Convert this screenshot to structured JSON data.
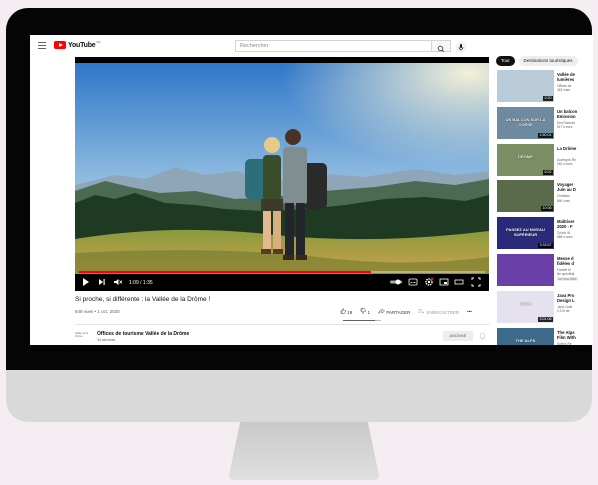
{
  "youtube": {
    "logo_text": "YouTube",
    "logo_region": "FR",
    "search_placeholder": "Rechercher",
    "chips": [
      "Tout",
      "Destinations touristiques"
    ],
    "player": {
      "time": "1:09 / 1:35",
      "progress_fraction": 0.72
    },
    "video": {
      "title": "Si proche, si différente : la Vallée de la Drôme !",
      "meta": "848 vues • 1 oct. 2020",
      "likes": "19",
      "dislikes": "1",
      "share_label": "PARTAGER",
      "save_label": "ENREGISTRER",
      "more": "•••"
    },
    "channel": {
      "name": "Offices de tourisme Vallée de la Drôme",
      "subscribers": "34 abonnés",
      "avatar_text": "Vallée de la Drôme",
      "subscribe_label": "ABONNÉ"
    },
    "related": [
      {
        "title_1": "Vallée de",
        "title_2": "lumières",
        "sub_1": "Offices de",
        "sub_2": "318 vues",
        "duration": "2:20",
        "color": "#b9cbd8"
      },
      {
        "title_1": "Un balcon",
        "title_2": "Emission",
        "sub_1": "Des Racines",
        "sub_2": "517 k vues",
        "duration": "1:50:01",
        "thumb_text": "UN BALCON SUR LA CORSE",
        "color": "#6e8aa0"
      },
      {
        "title_1": "La Drôme",
        "title_2": "",
        "sub_1": "Auvergne-Rh",
        "sub_2": "181 k vues",
        "duration": "6:02",
        "thumb_text": "DRÔME",
        "color": "#7b8d62"
      },
      {
        "title_1": "Voyager",
        "title_2": "Juin au D",
        "sub_1": "Christian",
        "sub_2": "846 vues",
        "duration": "10:06",
        "color": "#5a6b4c"
      },
      {
        "title_1": "Maîtriser",
        "title_2": "2020 - F",
        "sub_1": "Cédric W",
        "sub_2": "868 k vues",
        "duration": "3:33:57",
        "thumb_text": "PASSEZ AU NIVEAU SUPÉRIEUR",
        "color": "#2a2a7a"
      },
      {
        "title_1": "Messe d",
        "title_2": "fidèles d",
        "sub_1": "Famille M",
        "sub_2": "Ne spécifiait",
        "badge": "ACTUALITÉS",
        "color": "#6a3fa8"
      },
      {
        "title_1": "Java Pro",
        "title_2": "Design L",
        "sub_1": "Java Code",
        "sub_2": "2,3 M de",
        "duration": "3:01:06",
        "thumb_text": "#Java",
        "color": "#e6e1ef"
      },
      {
        "title_1": "The Alps",
        "title_2": "Film With",
        "sub_1": "Scenic Re",
        "sub_2": "",
        "thumb_text": "THE ALPS",
        "color": "#3e6a8a"
      }
    ]
  },
  "colors": {
    "accent": "#ff0000",
    "page_bg": "#f4eef2",
    "bezel": "#050505",
    "monitor_body": "#d9d9da"
  }
}
